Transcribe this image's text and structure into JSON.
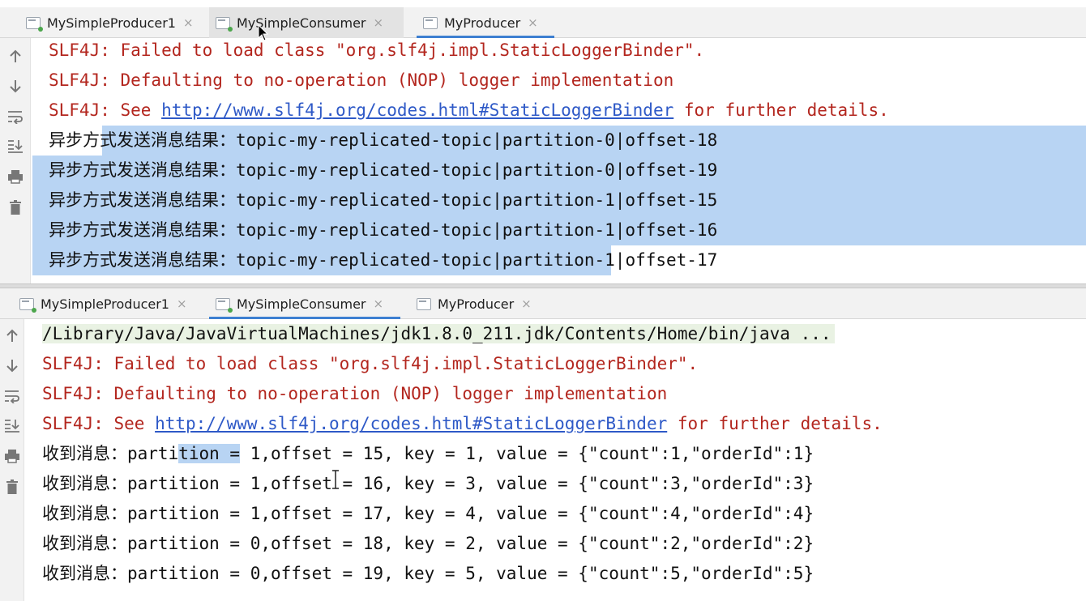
{
  "top_panel": {
    "tabs": [
      {
        "label": "MySimpleProducer1",
        "close": "×"
      },
      {
        "label": "MySimpleConsumer",
        "close": "×"
      },
      {
        "label": "MyProducer",
        "close": "×"
      }
    ],
    "log": [
      "SLF4J: Failed to load class \"org.slf4j.impl.StaticLoggerBinder\".",
      "SLF4J: Defaulting to no-operation (NOP) logger implementation"
    ],
    "see_prefix": "SLF4J: See ",
    "see_url": "http://www.slf4j.org/codes.html#StaticLoggerBinder",
    "see_suffix": " for further details.",
    "results": [
      {
        "a": "异步方",
        "b": "式发送消息结果：topic-my-replicated-topic|partition-0|offset-18"
      },
      {
        "a": "异步方式发送消息结果：topic-my-replicated-topic|partition-0|offset-19",
        "b": ""
      },
      {
        "a": "异步方式发送消息结果：topic-my-replicated-topic|partition-1|offset-15",
        "b": ""
      },
      {
        "a": "异步方式发送消息结果：topic-my-replicated-topic|partition-1|offset-16",
        "b": ""
      },
      {
        "a": "异步方式发送消息结果：topic-my-replicated-topic|parti",
        "b": "tion-1|offset-17"
      }
    ]
  },
  "bottom_panel": {
    "tabs": [
      {
        "label": "MySimpleProducer1",
        "close": "×"
      },
      {
        "label": "MySimpleConsumer",
        "close": "×"
      },
      {
        "label": "MyProducer",
        "close": "×"
      }
    ],
    "command": "/Library/Java/JavaVirtualMachines/jdk1.8.0_211.jdk/Contents/Home/bin/java ...",
    "log": [
      "SLF4J: Failed to load class \"org.slf4j.impl.StaticLoggerBinder\".",
      "SLF4J: Defaulting to no-operation (NOP) logger implementation"
    ],
    "see_prefix": "SLF4J: See ",
    "see_url": "http://www.slf4j.org/codes.html#StaticLoggerBinder",
    "see_suffix": " for further details.",
    "first_msg": {
      "a": "收到消息：parti",
      "b": "tion =",
      "c": " 1,offset = 15, key = 1, value = {\"count\":1,\"orderId\":1}"
    },
    "messages": [
      "收到消息：partition = 1,offset = 16, key = 3, value = {\"count\":3,\"orderId\":3}",
      "收到消息：partition = 1,offset = 17, key = 4, value = {\"count\":4,\"orderId\":4}",
      "收到消息：partition = 0,offset = 18, key = 2, value = {\"count\":2,\"orderId\":2}",
      "收到消息：partition = 0,offset = 19, key = 5, value = {\"count\":5,\"orderId\":5}"
    ]
  },
  "toolbar_icons": [
    "up-arrow-icon",
    "down-arrow-icon",
    "soft-wrap-icon",
    "scroll-to-end-icon",
    "print-icon",
    "trash-icon"
  ],
  "colors": {
    "error": "#b3261e",
    "link": "#2e59c7",
    "selection": "#b8d4f3",
    "tab_underline": "#3d7fd1"
  }
}
